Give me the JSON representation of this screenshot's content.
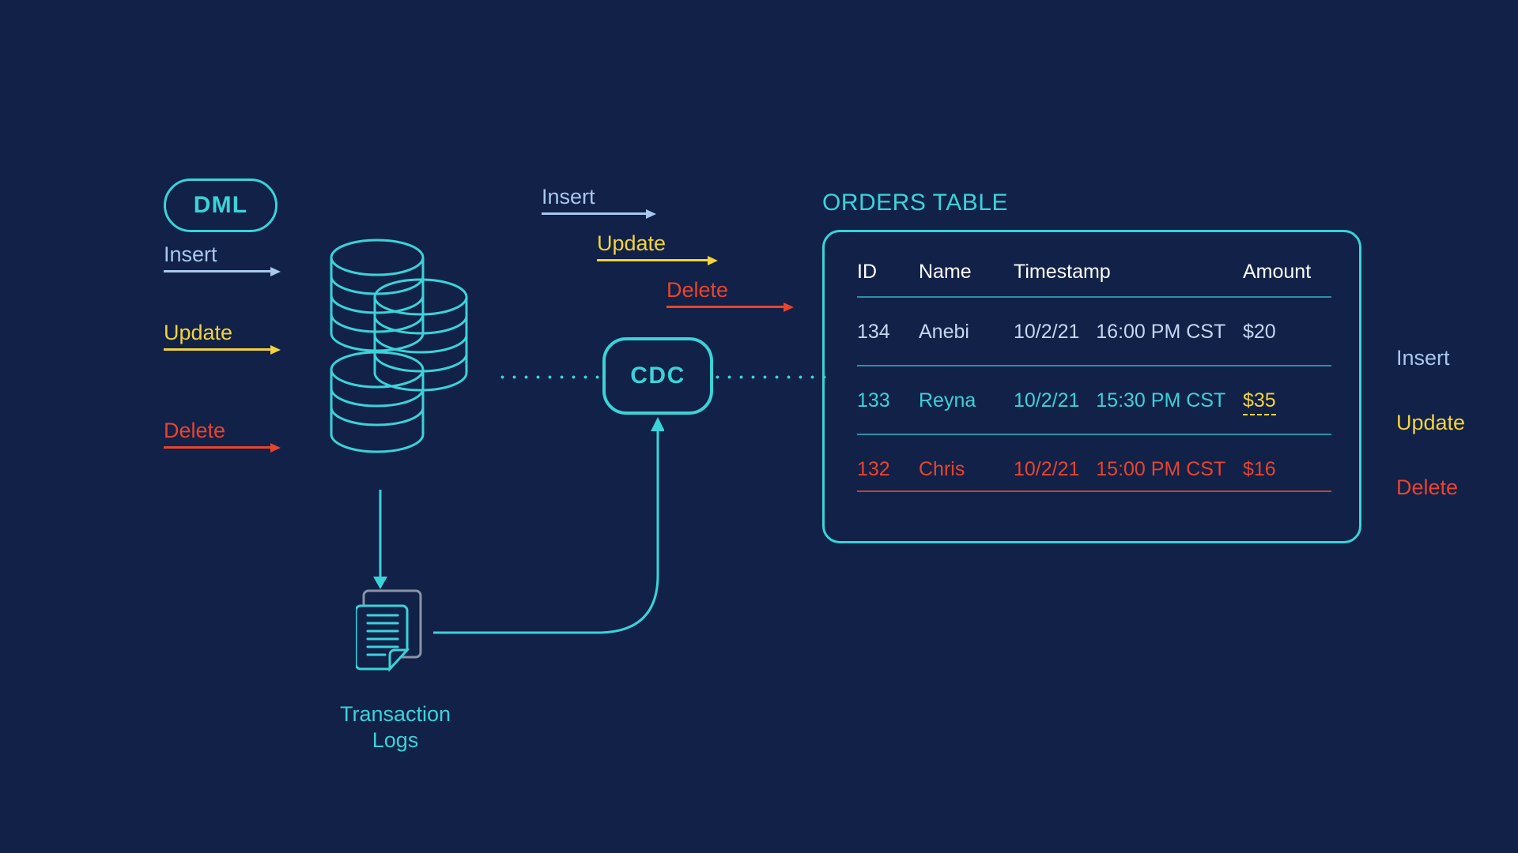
{
  "theme": {
    "background": "#122148",
    "cyan": "#3ad3d8",
    "insert_blue": "#a8c8ee",
    "update_yellow": "#f2d33c",
    "delete_red": "#e8442e",
    "rule_line": "#2f8fa8",
    "doc_grey": "#8a93a8"
  },
  "dml": {
    "label": "DML"
  },
  "source_arrows": [
    {
      "label": "Insert",
      "color_key": "insert_blue"
    },
    {
      "label": "Update",
      "color_key": "update_yellow"
    },
    {
      "label": "Delete",
      "color_key": "delete_red"
    }
  ],
  "mid_arrows": [
    {
      "label": "Insert",
      "color_key": "insert_blue"
    },
    {
      "label": "Update",
      "color_key": "update_yellow"
    },
    {
      "label": "Delete",
      "color_key": "delete_red"
    }
  ],
  "cdc": {
    "label": "CDC"
  },
  "transaction_logs": {
    "label_line1": "Transaction",
    "label_line2": "Logs"
  },
  "orders_table": {
    "title": "ORDERS TABLE",
    "columns": [
      "ID",
      "Name",
      "Timestamp",
      "Amount"
    ],
    "rows": [
      {
        "op": "insert",
        "id": "134",
        "name": "Anebi",
        "date": "10/2/21",
        "time": "16:00 PM CST",
        "amount": "$20"
      },
      {
        "op": "update",
        "id": "133",
        "name": "Reyna",
        "date": "10/2/21",
        "time": "15:30 PM CST",
        "amount": "$35"
      },
      {
        "op": "delete",
        "id": "132",
        "name": "Chris",
        "date": "10/2/21",
        "time": "15:00 PM CST",
        "amount": "$16"
      }
    ]
  },
  "legend": [
    {
      "label": "Insert",
      "color_key": "insert_blue"
    },
    {
      "label": "Update",
      "color_key": "update_yellow"
    },
    {
      "label": "Delete",
      "color_key": "delete_red"
    }
  ]
}
